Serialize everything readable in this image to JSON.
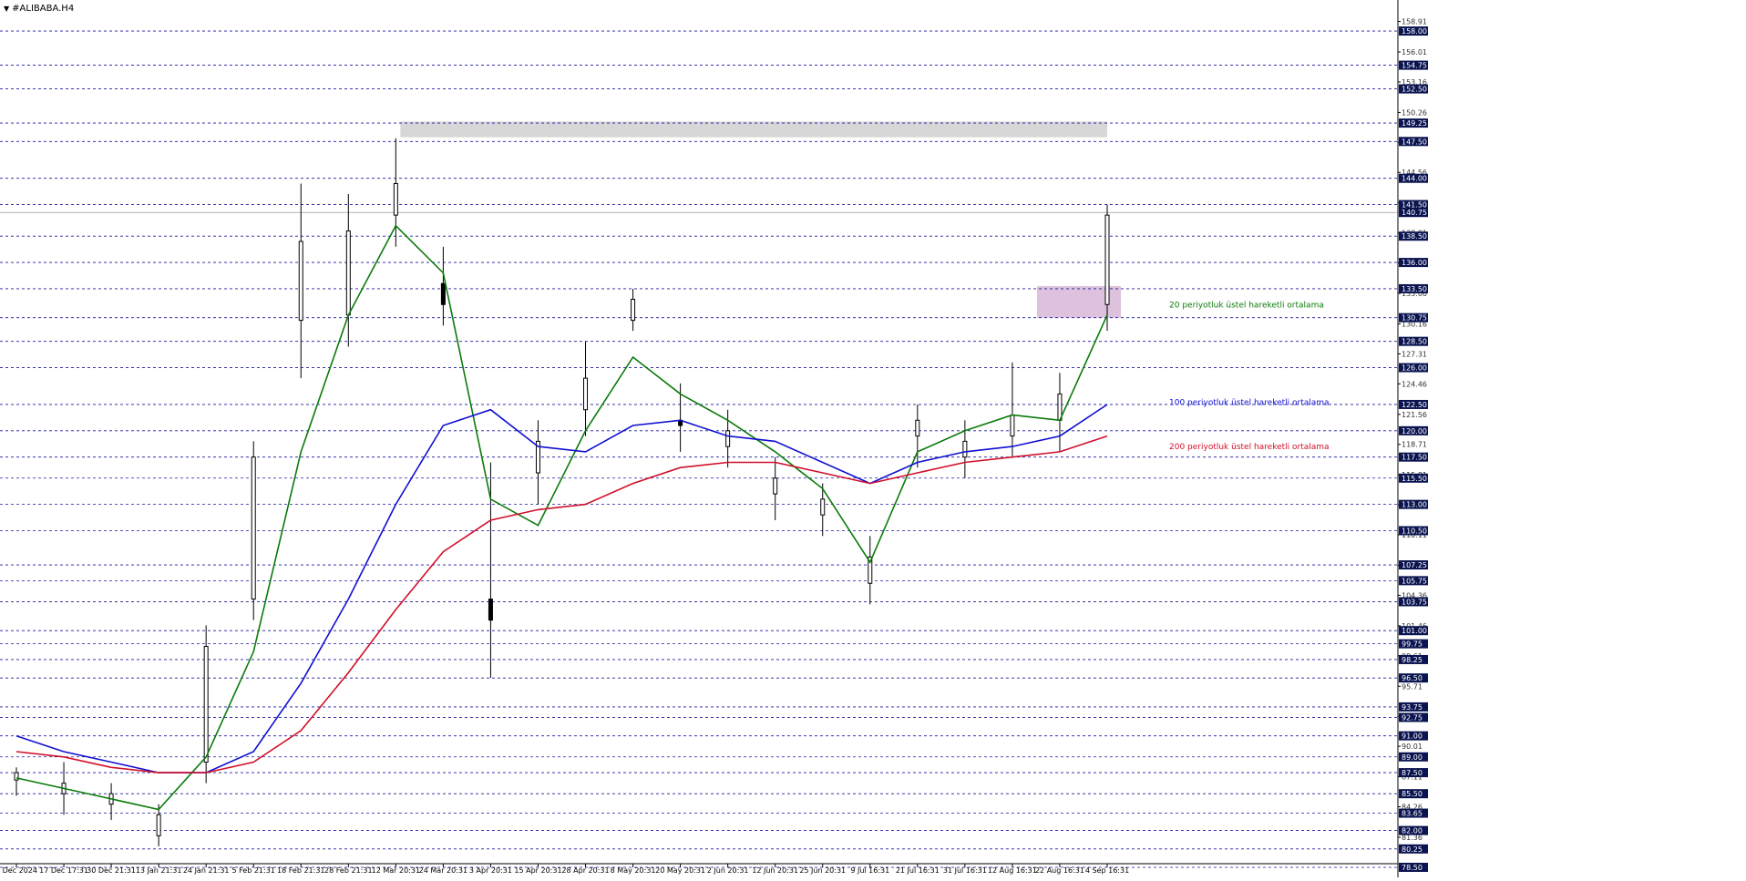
{
  "window": {
    "symbol_title": "#ALIBABA.H4"
  },
  "colors": {
    "background": "#ffffff",
    "grid": "#1a1aa0",
    "candle": "#000000",
    "ema20": "#0a7a0a",
    "ema100": "#1010d0",
    "ema200": "#d0102a",
    "resistance_zone": "#d3d3d3",
    "support_zone": "#d7b6d7",
    "price_label_bg": "#0a1450",
    "current_price_line": "#b0b0b0"
  },
  "annotations": {
    "ema20_label": "20 periyotluk üstel hareketli ortalama",
    "ema100_label": "100 periyotluk üstel hareketli ortalama",
    "ema200_label": "200 periyotluk üstel hareketli ortalama"
  },
  "chart_data": {
    "type": "candlestick",
    "title": "#ALIBABA.H4",
    "ylim": [
      78.5,
      159.91
    ],
    "current_price": 140.75,
    "x_labels": [
      "5 Dec 2024",
      "17 Dec 17:31",
      "30 Dec 21:31",
      "13 Jan 21:31",
      "24 Jan 21:31",
      "5 Feb 21:31",
      "18 Feb 21:31",
      "28 Feb 21:31",
      "12 Mar 20:31",
      "24 Mar 20:31",
      "3 Apr 20:31",
      "15 Apr 20:31",
      "28 Apr 20:31",
      "8 May 20:31",
      "20 May 20:31",
      "2 Jun 20:31",
      "12 Jun 20:31",
      "25 Jun 20:31",
      "9 Jul 16:31",
      "21 Jul 16:31",
      "31 Jul 16:31",
      "12 Aug 16:31",
      "22 Aug 16:31",
      "4 Sep 16:31"
    ],
    "horizontal_levels": [
      158.0,
      154.75,
      152.5,
      149.25,
      147.5,
      144.0,
      141.5,
      138.5,
      136.0,
      133.5,
      130.75,
      128.5,
      126.0,
      122.5,
      120.0,
      117.5,
      115.5,
      113.0,
      110.5,
      107.25,
      105.75,
      103.75,
      101.0,
      99.75,
      98.25,
      96.5,
      93.75,
      92.75,
      91.0,
      89.0,
      87.5,
      85.5,
      83.65,
      82.0,
      80.25,
      78.5
    ],
    "axis_scale_ticks": [
      "158.91",
      "156.01",
      "153.16",
      "150.26",
      "147.41",
      "144.56",
      "141.66",
      "138.81",
      "135.96",
      "133.06",
      "130.16",
      "127.31",
      "124.46",
      "121.56",
      "118.71",
      "115.81",
      "112.96",
      "110.11",
      "107.21",
      "104.36",
      "101.46",
      "98.61",
      "95.71",
      "92.86",
      "90.01",
      "87.11",
      "84.26",
      "81.36"
    ],
    "zones": [
      {
        "kind": "resistance",
        "y_low": 147.9,
        "y_high": 149.4,
        "x_from": "12 Mar 20:31",
        "x_to": "4 Sep 16:31"
      },
      {
        "kind": "support",
        "y_low": 130.75,
        "y_high": 133.75,
        "x_from": "22 Aug 16:31",
        "x_to": "4 Sep 16:31"
      }
    ],
    "series": [
      {
        "name": "20 periyotluk üstel hareketli ortalama",
        "period": 20,
        "points": [
          [
            "5 Dec 2024",
            87.0
          ],
          [
            "17 Dec 17:31",
            86.0
          ],
          [
            "30 Dec 21:31",
            85.0
          ],
          [
            "13 Jan 21:31",
            84.0
          ],
          [
            "24 Jan 21:31",
            89.0
          ],
          [
            "5 Feb 21:31",
            99.0
          ],
          [
            "18 Feb 21:31",
            118.0
          ],
          [
            "28 Feb 21:31",
            131.0
          ],
          [
            "12 Mar 20:31",
            139.5
          ],
          [
            "24 Mar 20:31",
            135.0
          ],
          [
            "3 Apr 20:31",
            113.5
          ],
          [
            "15 Apr 20:31",
            111.0
          ],
          [
            "28 Apr 20:31",
            120.0
          ],
          [
            "8 May 20:31",
            127.0
          ],
          [
            "20 May 20:31",
            123.5
          ],
          [
            "2 Jun 20:31",
            121.0
          ],
          [
            "12 Jun 20:31",
            118.0
          ],
          [
            "25 Jun 20:31",
            114.5
          ],
          [
            "9 Jul 16:31",
            107.5
          ],
          [
            "21 Jul 16:31",
            118.0
          ],
          [
            "31 Jul 16:31",
            120.0
          ],
          [
            "12 Aug 16:31",
            121.5
          ],
          [
            "22 Aug 16:31",
            121.0
          ],
          [
            "4 Sep 16:31",
            131.0
          ]
        ]
      },
      {
        "name": "100 periyotluk üstel hareketli ortalama",
        "period": 100,
        "points": [
          [
            "5 Dec 2024",
            91.0
          ],
          [
            "17 Dec 17:31",
            89.5
          ],
          [
            "30 Dec 21:31",
            88.5
          ],
          [
            "13 Jan 21:31",
            87.5
          ],
          [
            "24 Jan 21:31",
            87.5
          ],
          [
            "5 Feb 21:31",
            89.5
          ],
          [
            "18 Feb 21:31",
            96.0
          ],
          [
            "28 Feb 21:31",
            104.0
          ],
          [
            "12 Mar 20:31",
            113.0
          ],
          [
            "24 Mar 20:31",
            120.5
          ],
          [
            "3 Apr 20:31",
            122.0
          ],
          [
            "15 Apr 20:31",
            118.5
          ],
          [
            "28 Apr 20:31",
            118.0
          ],
          [
            "8 May 20:31",
            120.5
          ],
          [
            "20 May 20:31",
            121.0
          ],
          [
            "2 Jun 20:31",
            119.5
          ],
          [
            "12 Jun 20:31",
            119.0
          ],
          [
            "25 Jun 20:31",
            117.0
          ],
          [
            "9 Jul 16:31",
            115.0
          ],
          [
            "21 Jul 16:31",
            117.0
          ],
          [
            "31 Jul 16:31",
            118.0
          ],
          [
            "12 Aug 16:31",
            118.5
          ],
          [
            "22 Aug 16:31",
            119.5
          ],
          [
            "4 Sep 16:31",
            122.5
          ]
        ]
      },
      {
        "name": "200 periyotluk üstel hareketli ortalama",
        "period": 200,
        "points": [
          [
            "5 Dec 2024",
            89.5
          ],
          [
            "17 Dec 17:31",
            89.0
          ],
          [
            "30 Dec 21:31",
            88.0
          ],
          [
            "13 Jan 21:31",
            87.5
          ],
          [
            "24 Jan 21:31",
            87.5
          ],
          [
            "5 Feb 21:31",
            88.5
          ],
          [
            "18 Feb 21:31",
            91.5
          ],
          [
            "28 Feb 21:31",
            97.0
          ],
          [
            "12 Mar 20:31",
            103.0
          ],
          [
            "24 Mar 20:31",
            108.5
          ],
          [
            "3 Apr 20:31",
            111.5
          ],
          [
            "15 Apr 20:31",
            112.5
          ],
          [
            "28 Apr 20:31",
            113.0
          ],
          [
            "8 May 20:31",
            115.0
          ],
          [
            "20 May 20:31",
            116.5
          ],
          [
            "2 Jun 20:31",
            117.0
          ],
          [
            "12 Jun 20:31",
            117.0
          ],
          [
            "25 Jun 20:31",
            116.0
          ],
          [
            "9 Jul 16:31",
            115.0
          ],
          [
            "21 Jul 16:31",
            116.0
          ],
          [
            "31 Jul 16:31",
            117.0
          ],
          [
            "12 Aug 16:31",
            117.5
          ],
          [
            "22 Aug 16:31",
            118.0
          ],
          [
            "4 Sep 16:31",
            119.5
          ]
        ]
      }
    ],
    "candles": [
      {
        "x": "5 Dec 2024",
        "o": 86.8,
        "h": 88.0,
        "l": 85.3,
        "c": 87.5
      },
      {
        "x": "17 Dec 17:31",
        "o": 85.5,
        "h": 88.5,
        "l": 83.5,
        "c": 86.5
      },
      {
        "x": "30 Dec 21:31",
        "o": 84.5,
        "h": 86.5,
        "l": 83.0,
        "c": 85.5
      },
      {
        "x": "13 Jan 21:31",
        "o": 81.5,
        "h": 84.5,
        "l": 80.5,
        "c": 83.5
      },
      {
        "x": "24 Jan 21:31",
        "o": 88.5,
        "h": 101.5,
        "l": 86.5,
        "c": 99.5
      },
      {
        "x": "5 Feb 21:31",
        "o": 104.0,
        "h": 119.0,
        "l": 102.0,
        "c": 117.5
      },
      {
        "x": "18 Feb 21:31",
        "o": 130.5,
        "h": 143.5,
        "l": 125.0,
        "c": 138.0
      },
      {
        "x": "28 Feb 21:31",
        "o": 131.0,
        "h": 142.5,
        "l": 128.0,
        "c": 139.0
      },
      {
        "x": "12 Mar 20:31",
        "o": 140.5,
        "h": 147.8,
        "l": 137.5,
        "c": 143.5
      },
      {
        "x": "24 Mar 20:31",
        "o": 134.0,
        "h": 137.5,
        "l": 130.0,
        "c": 132.0
      },
      {
        "x": "3 Apr 20:31",
        "o": 104.0,
        "h": 117.0,
        "l": 96.5,
        "c": 102.0
      },
      {
        "x": "15 Apr 20:31",
        "o": 116.0,
        "h": 121.0,
        "l": 113.0,
        "c": 119.0
      },
      {
        "x": "28 Apr 20:31",
        "o": 122.0,
        "h": 128.5,
        "l": 119.5,
        "c": 125.0
      },
      {
        "x": "8 May 20:31",
        "o": 130.5,
        "h": 133.5,
        "l": 129.5,
        "c": 132.5
      },
      {
        "x": "20 May 20:31",
        "o": 121.0,
        "h": 124.5,
        "l": 118.0,
        "c": 120.5
      },
      {
        "x": "2 Jun 20:31",
        "o": 118.5,
        "h": 122.0,
        "l": 116.5,
        "c": 120.0
      },
      {
        "x": "12 Jun 20:31",
        "o": 114.0,
        "h": 117.5,
        "l": 111.5,
        "c": 115.5
      },
      {
        "x": "25 Jun 20:31",
        "o": 112.0,
        "h": 115.0,
        "l": 110.0,
        "c": 113.5
      },
      {
        "x": "9 Jul 16:31",
        "o": 105.5,
        "h": 110.0,
        "l": 103.5,
        "c": 108.0
      },
      {
        "x": "21 Jul 16:31",
        "o": 119.5,
        "h": 122.5,
        "l": 116.5,
        "c": 121.0
      },
      {
        "x": "31 Jul 16:31",
        "o": 117.5,
        "h": 121.0,
        "l": 115.5,
        "c": 119.0
      },
      {
        "x": "12 Aug 16:31",
        "o": 119.5,
        "h": 126.5,
        "l": 117.5,
        "c": 121.5
      },
      {
        "x": "22 Aug 16:31",
        "o": 121.0,
        "h": 125.5,
        "l": 118.0,
        "c": 123.5
      },
      {
        "x": "4 Sep 16:31",
        "o": 132.0,
        "h": 141.5,
        "l": 129.5,
        "c": 140.5
      }
    ]
  }
}
